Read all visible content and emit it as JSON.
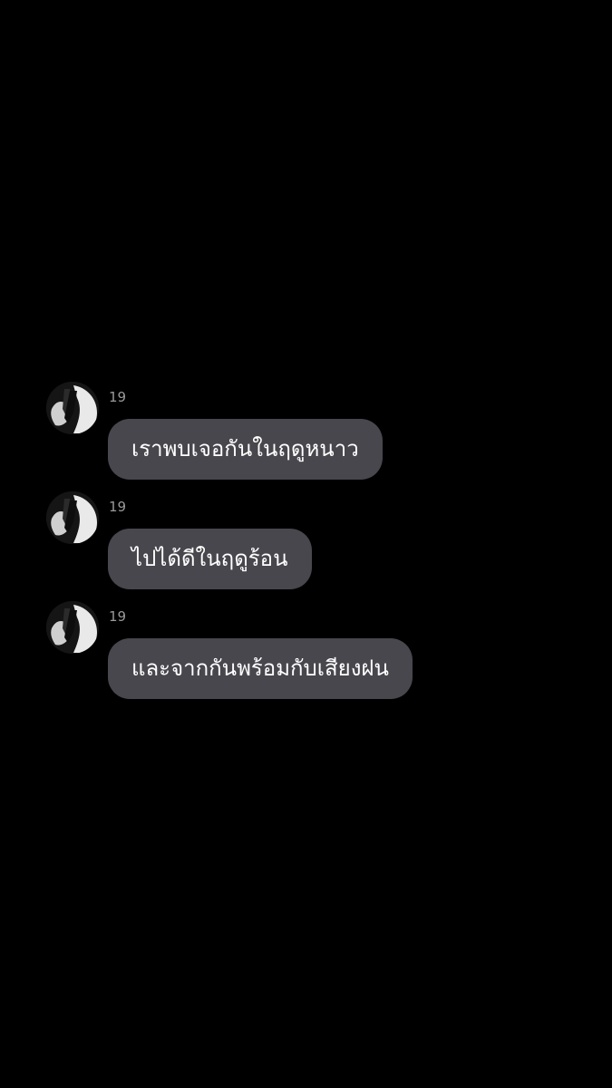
{
  "chat": {
    "background_color": "#000000",
    "bubble_color": "#47474d",
    "messages": [
      {
        "sender": "19",
        "avatar_icon": "avatar-icon",
        "text": "เราพบเจอกันในฤดูหนาว"
      },
      {
        "sender": "19",
        "avatar_icon": "avatar-icon",
        "text": "ไปได้ดีในฤดูร้อน"
      },
      {
        "sender": "19",
        "avatar_icon": "avatar-icon",
        "text": "และจากกันพร้อมกับเสียงฝน"
      }
    ]
  }
}
